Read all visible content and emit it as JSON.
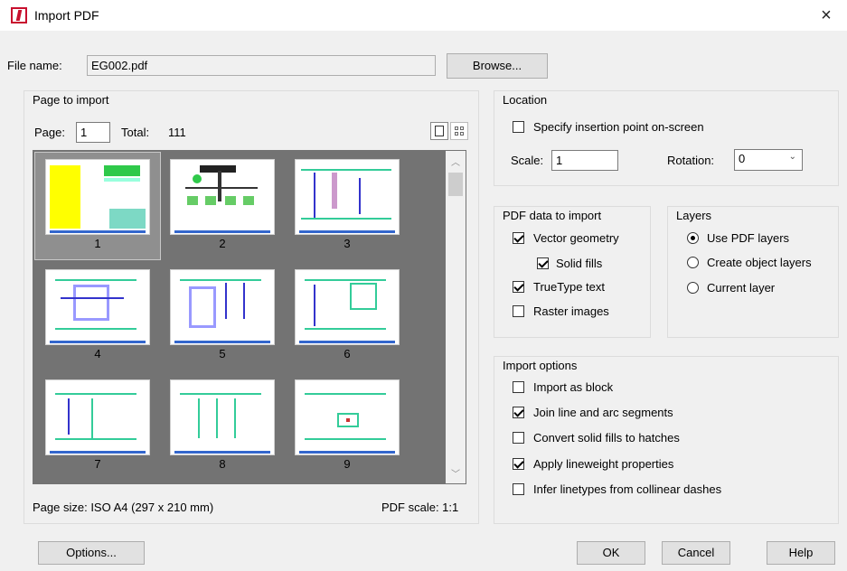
{
  "window": {
    "title": "Import PDF",
    "close_glyph": "×",
    "icon": "app-logo-icon"
  },
  "file": {
    "label": "File name:",
    "value": "EG002.pdf",
    "browse_label": "Browse..."
  },
  "page_group": {
    "title": "Page to import",
    "page_label": "Page:",
    "page_value": "1",
    "total_label": "Total:",
    "total_value": "111",
    "thumbnails": [
      "1",
      "2",
      "3",
      "4",
      "5",
      "6",
      "7",
      "8",
      "9"
    ],
    "selected": "1",
    "page_size": "Page size:  ISO A4 (297 x 210 mm)",
    "pdf_scale": "PDF scale:  1:1"
  },
  "location": {
    "title": "Location",
    "specify_label": "Specify insertion point on-screen",
    "specify_checked": false,
    "scale_label": "Scale:",
    "scale_value": "1",
    "rotation_label": "Rotation:",
    "rotation_value": "0"
  },
  "pdf_data": {
    "title": "PDF data to import",
    "vector_label": "Vector geometry",
    "solid_label": "Solid fills",
    "truetype_label": "TrueType text",
    "raster_label": "Raster images"
  },
  "layers": {
    "title": "Layers",
    "use_pdf_label": "Use PDF layers",
    "create_label": "Create object layers",
    "current_label": "Current layer"
  },
  "import_options": {
    "title": "Import options",
    "block_label": "Import as block",
    "join_label": "Join line and arc segments",
    "convert_label": "Convert solid fills to hatches",
    "lineweight_label": "Apply lineweight properties",
    "infer_label": "Infer linetypes from collinear dashes"
  },
  "buttons": {
    "options": "Options...",
    "ok": "OK",
    "cancel": "Cancel",
    "help": "Help"
  },
  "colors": {
    "thumb_bg": "#737373",
    "accent_red": "#c8102e"
  }
}
